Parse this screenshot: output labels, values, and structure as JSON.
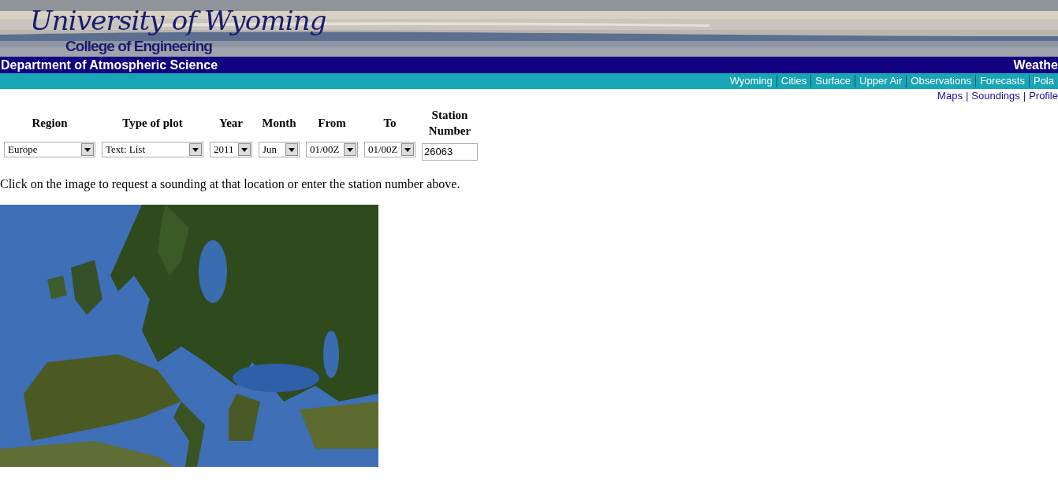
{
  "banner": {
    "title": "University of Wyoming",
    "subtitle": "College of Engineering"
  },
  "department_bar": {
    "left": "Department of Atmospheric Science",
    "right": "Weathe"
  },
  "nav_links": [
    "Wyoming",
    "Cities",
    "Surface",
    "Upper Air",
    "Observations",
    "Forecasts",
    "Pola"
  ],
  "sub_links": {
    "separator": "|",
    "items": [
      "Maps",
      "Soundings",
      "Profile"
    ]
  },
  "form": {
    "fields": [
      {
        "label": "Region",
        "kind": "select",
        "value": "Europe"
      },
      {
        "label": "Type of plot",
        "kind": "select",
        "value": "Text: List"
      },
      {
        "label": "Year",
        "kind": "select",
        "value": "2011"
      },
      {
        "label": "Month",
        "kind": "select",
        "value": "Jun"
      },
      {
        "label": "From",
        "kind": "select",
        "value": "01/00Z"
      },
      {
        "label": "To",
        "kind": "select",
        "value": "01/00Z"
      },
      {
        "label": "Station Number",
        "kind": "text",
        "value": "26063"
      }
    ]
  },
  "instructions": "Click on the image to request a sounding at that location or enter the station number above."
}
